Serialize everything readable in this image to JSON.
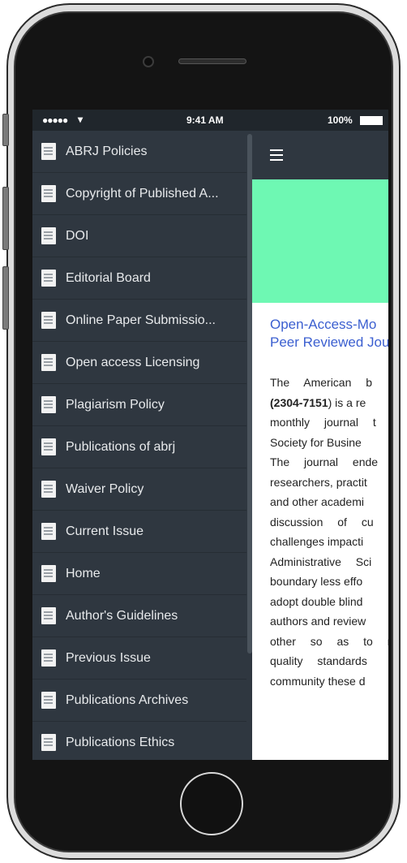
{
  "status_bar": {
    "signal": "●●●●● ",
    "wifi": "▾",
    "time": "9:41 AM",
    "battery": "100%"
  },
  "sidebar": {
    "items": [
      {
        "label": "ABRJ Policies"
      },
      {
        "label": "Copyright of Published A..."
      },
      {
        "label": "DOI"
      },
      {
        "label": "Editorial Board"
      },
      {
        "label": "Online Paper Submissio..."
      },
      {
        "label": "Open access Licensing"
      },
      {
        "label": "Plagiarism Policy"
      },
      {
        "label": "Publications of abrj"
      },
      {
        "label": "Waiver Policy"
      },
      {
        "label": "Current Issue"
      },
      {
        "label": "Home"
      },
      {
        "label": "Author's Guidelines"
      },
      {
        "label": "Previous Issue"
      },
      {
        "label": "Publications Archives"
      },
      {
        "label": "Publications Ethics"
      }
    ]
  },
  "main": {
    "title_lines": [
      "Open-Access-Mo",
      "Peer Reviewed Jou"
    ],
    "body": {
      "line1": "The American b",
      "issn": "(2304-7151",
      "line2_rest": ") is a re",
      "lines": [
        "monthly journal t",
        "Society for Busine",
        "The journal ende",
        "researchers, practit",
        "and other academi",
        "discussion of cu",
        "challenges impacti",
        "Administrative Sci",
        "boundary less effo",
        "adopt double blind",
        "authors and review",
        "other so as to m",
        "quality standards",
        "community these d"
      ]
    }
  }
}
